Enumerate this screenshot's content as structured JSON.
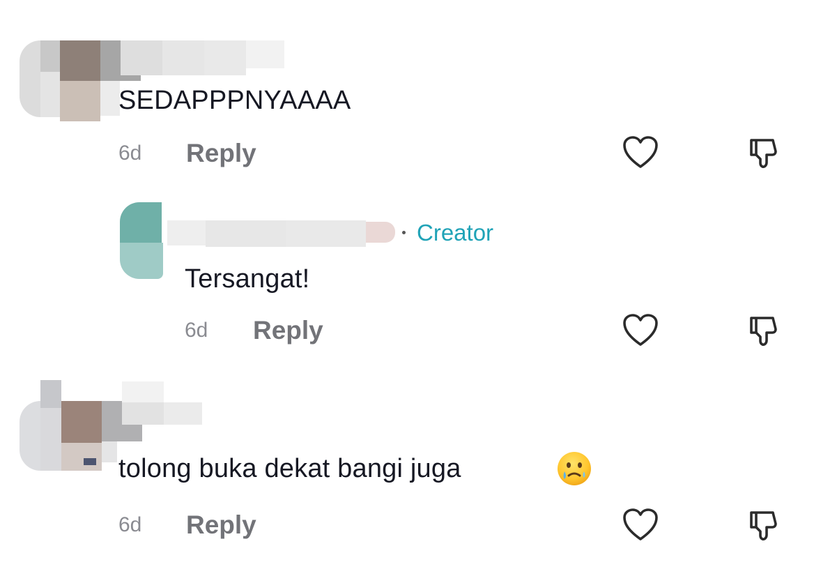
{
  "comments": [
    {
      "text": "SEDAPPPNYAAAA",
      "time": "6d",
      "reply_label": "Reply"
    },
    {
      "is_reply": true,
      "badge": "Creator",
      "text": "Tersangat!",
      "time": "6d",
      "reply_label": "Reply"
    },
    {
      "text": "tolong buka dekat bangi juga",
      "emoji": "holding-back-tears-emoji",
      "time": "6d",
      "reply_label": "Reply"
    }
  ],
  "icons": {
    "like": "heart-outline-icon",
    "dislike": "thumbs-down-outline-icon"
  },
  "colors": {
    "text": "#161823",
    "meta": "#8a8b91",
    "reply": "#727378",
    "creator": "#20a3b7"
  }
}
